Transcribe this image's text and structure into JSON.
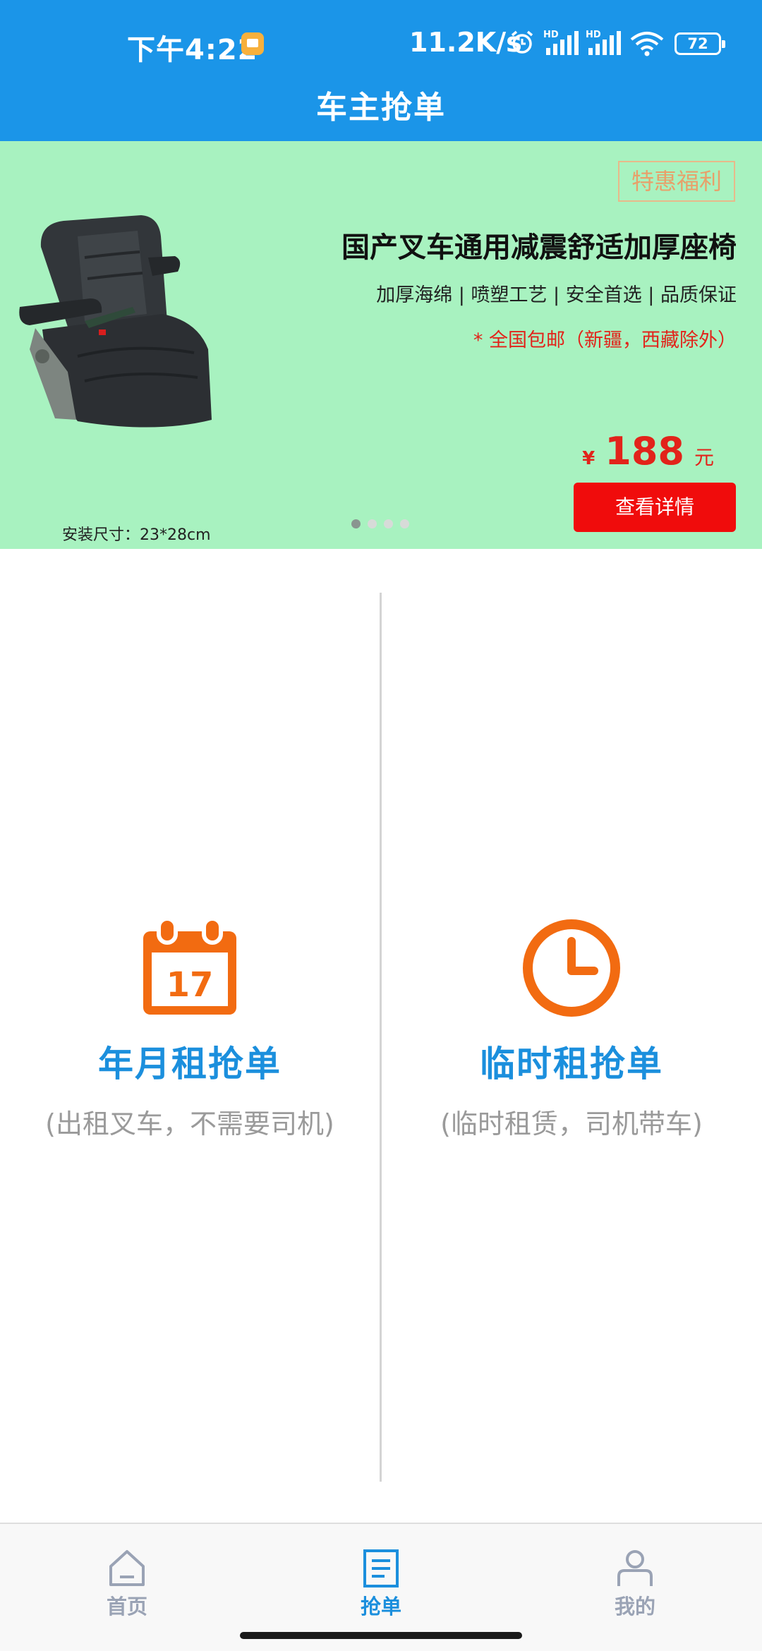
{
  "status_bar": {
    "time": "下午4:22",
    "net_speed": "11.2K/s",
    "battery": "72"
  },
  "header": {
    "title": "车主抢单"
  },
  "banner": {
    "promo_tag": "特惠福利",
    "product_title": "国产叉车通用减震舒适加厚座椅",
    "features": "加厚海绵 | 喷塑工艺 | 安全首选 | 品质保证",
    "shipping": "* 全国包邮（新疆，西藏除外）",
    "price_symbol": "¥",
    "price": "188",
    "price_unit": "元",
    "detail_button": "查看详情",
    "install_size": "安装尺寸：23*28cm",
    "slide_count": 4,
    "active_slide": 1
  },
  "options": [
    {
      "title": "年月租抢单",
      "subtitle": "(出租叉车，不需要司机)",
      "icon": "calendar-icon",
      "calendar_day": "17",
      "color": "#f26b11"
    },
    {
      "title": "临时租抢单",
      "subtitle": "(临时租赁，司机带车)",
      "icon": "clock-icon",
      "color": "#f26b11"
    }
  ],
  "bottom_nav": [
    {
      "label": "首页",
      "icon": "home-icon",
      "active": false
    },
    {
      "label": "抢单",
      "icon": "document-icon",
      "active": true
    },
    {
      "label": "我的",
      "icon": "user-icon",
      "active": false
    }
  ],
  "colors": {
    "primary": "#1b95e8",
    "banner_bg": "#a8f2c0",
    "price_red": "#e2231a",
    "accent_orange": "#f26b11",
    "nav_inactive": "#9aa3b5"
  }
}
